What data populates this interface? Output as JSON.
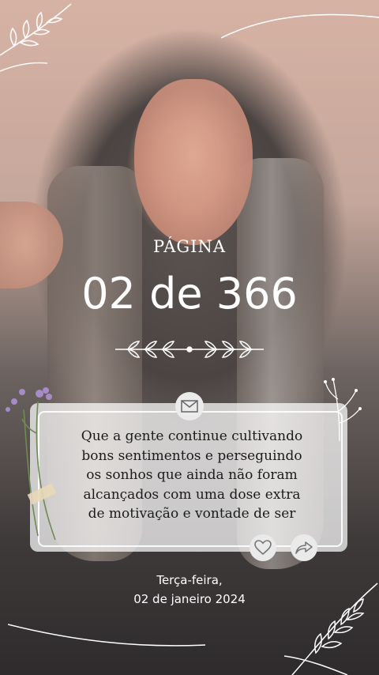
{
  "header": {
    "label": "PÁGINA",
    "counter": "02 de 366"
  },
  "message": {
    "lines": [
      "Que a gente continue cultivando",
      "bons sentimentos e perseguindo",
      "os sonhos que ainda não foram",
      "alcançados com uma dose extra",
      "de motivação e vontade de ser"
    ]
  },
  "footer": {
    "weekday": "Terça-feira,",
    "date": "02 de janeiro 2024"
  },
  "icons": {
    "badge": "envelope-icon",
    "like": "heart-icon",
    "share": "share-arrow-icon"
  },
  "colors": {
    "text": "#ffffff",
    "card": "#f2f2f2",
    "quote_text": "#1b1b1b"
  }
}
